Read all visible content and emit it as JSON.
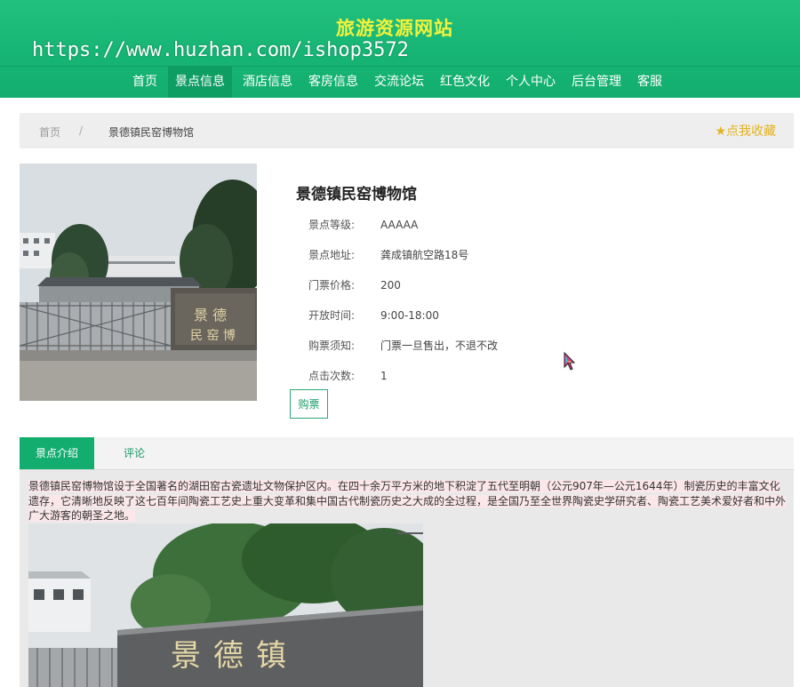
{
  "header": {
    "site_title": "旅游资源网站",
    "watermark": "https://www.huzhan.com/ishop3572",
    "nav": [
      {
        "label": "首页",
        "active": false
      },
      {
        "label": "景点信息",
        "active": true
      },
      {
        "label": "酒店信息",
        "active": false
      },
      {
        "label": "客房信息",
        "active": false
      },
      {
        "label": "交流论坛",
        "active": false
      },
      {
        "label": "红色文化",
        "active": false
      },
      {
        "label": "个人中心",
        "active": false
      },
      {
        "label": "后台管理",
        "active": false
      },
      {
        "label": "客服",
        "active": false
      }
    ]
  },
  "breadcrumb": {
    "home": "首页",
    "separator": "/",
    "current": "景德镇民窑博物馆",
    "favorite_label": "点我收藏",
    "favorite_icon": "star-icon"
  },
  "detail": {
    "title": "景德镇民窑博物馆",
    "fields": [
      {
        "label": "景点等级:",
        "value": "AAAAA"
      },
      {
        "label": "景点地址:",
        "value": "龚成镇航空路18号"
      },
      {
        "label": "门票价格:",
        "value": "200"
      },
      {
        "label": "开放时间:",
        "value": "9:00-18:00"
      },
      {
        "label": "购票须知:",
        "value": "门票一旦售出，不退不改"
      },
      {
        "label": "点击次数:",
        "value": "1"
      }
    ],
    "buy_label": "购票"
  },
  "tabs": [
    {
      "label": "景点介绍",
      "active": true
    },
    {
      "label": "评论",
      "active": false
    }
  ],
  "content": {
    "description": "景德镇民窑博物馆设于全国著名的湖田窑古瓷遗址文物保护区内。在四十余万平方米的地下积淀了五代至明朝（公元907年—公元1644年）制瓷历史的丰富文化遗存，它清晰地反映了这七百年间陶瓷工艺史上重大变革和集中国古代制瓷历史之大成的全过程，是全国乃至全世界陶瓷史学研究者、陶瓷工艺美术爱好者和中外广大游客的朝圣之地。",
    "photo_sign_text": "景德镇"
  },
  "colors": {
    "brand_green": "#13ae6f",
    "title_yellow": "#f4f23a",
    "favorite_gold": "#e3b21c"
  }
}
